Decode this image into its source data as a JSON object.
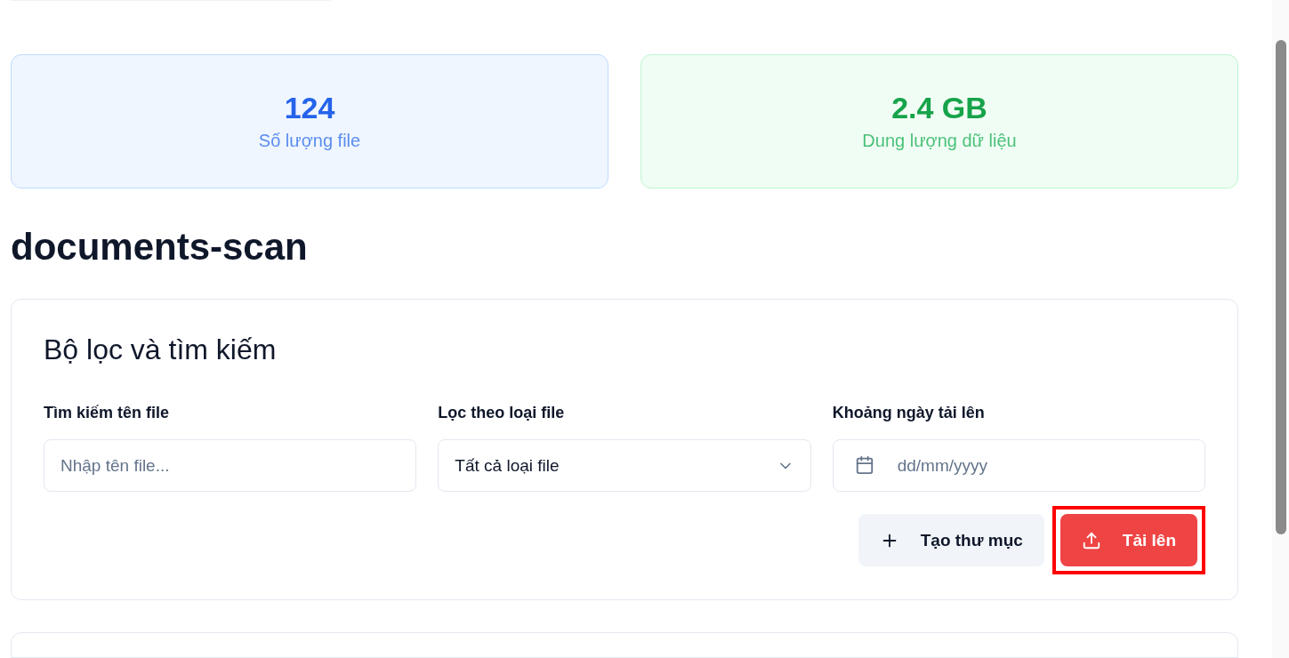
{
  "stats": [
    {
      "value": "124",
      "label": "Số lượng file",
      "color": "#2563eb"
    },
    {
      "value": "2.4 GB",
      "label": "Dung lượng dữ liệu",
      "color": "#16a34a"
    }
  ],
  "folder_title": "documents-scan",
  "filter_panel": {
    "title": "Bộ lọc và tìm kiếm",
    "fields": [
      {
        "kind": "text",
        "label": "Tìm kiếm tên file",
        "placeholder": "Nhập tên file..."
      },
      {
        "kind": "select",
        "label": "Lọc theo loại file",
        "value": "Tất cả loại file"
      },
      {
        "kind": "date",
        "label": "Khoảng ngày tải lên",
        "placeholder": "dd/mm/yyyy"
      }
    ],
    "buttons": [
      {
        "kind": "secondary",
        "label": "Tạo thư mục",
        "highlighted": false
      },
      {
        "kind": "primary",
        "label": "Tải lên",
        "highlighted": true
      }
    ]
  }
}
